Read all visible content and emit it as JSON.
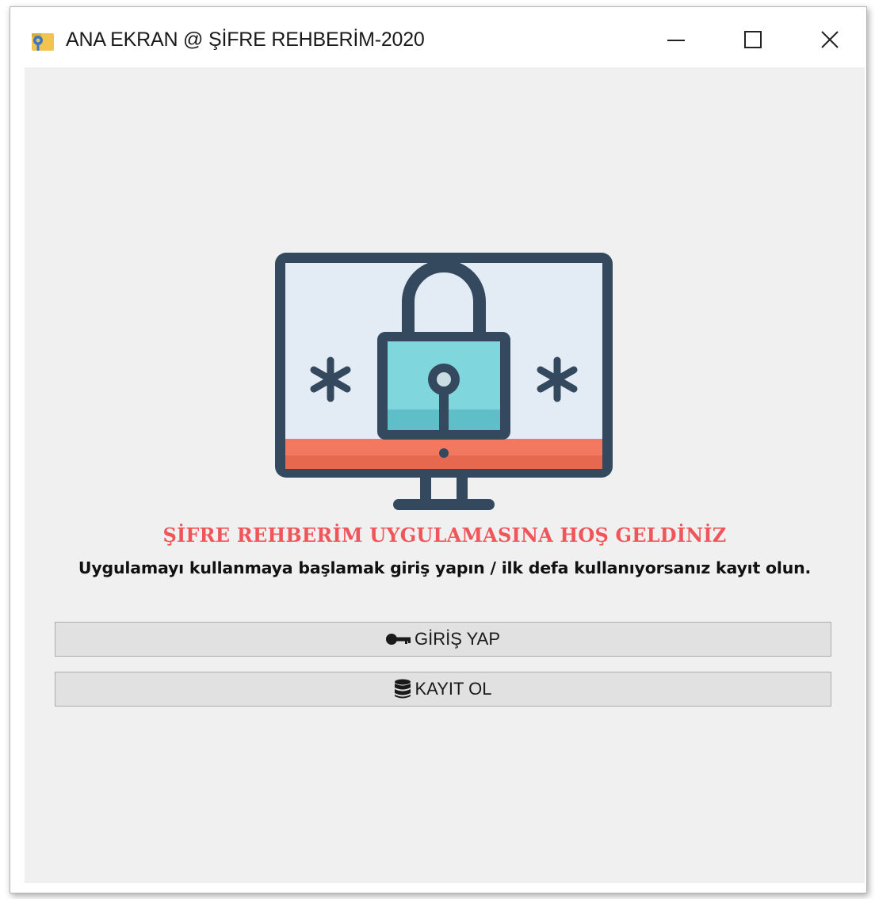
{
  "window": {
    "title": "ANA EKRAN @ ŞİFRE REHBERİM-2020",
    "app_icon": "key-folder-icon",
    "controls": {
      "minimize_icon": "minimize-icon",
      "maximize_icon": "maximize-icon",
      "close_icon": "close-icon"
    }
  },
  "hero": {
    "illustration": "monitor-padlock-icon",
    "colors": {
      "frame": "#34495e",
      "screen": "#e3ecf5",
      "lock_body": "#7fd6dd",
      "base_band": "#f27860"
    }
  },
  "main": {
    "welcome_text": "ŞİFRE REHBERİM UYGULAMASINA HOŞ GELDİNİZ",
    "welcome_color": "#f0555a",
    "instruction_text": "Uygulamayı kullanmaya başlamak giriş yapın / ilk defa kullanıyorsanız kayıt olun."
  },
  "buttons": {
    "login": {
      "label": "GİRİŞ YAP",
      "icon": "key-icon"
    },
    "register": {
      "label": "KAYIT OL",
      "icon": "database-icon"
    }
  }
}
